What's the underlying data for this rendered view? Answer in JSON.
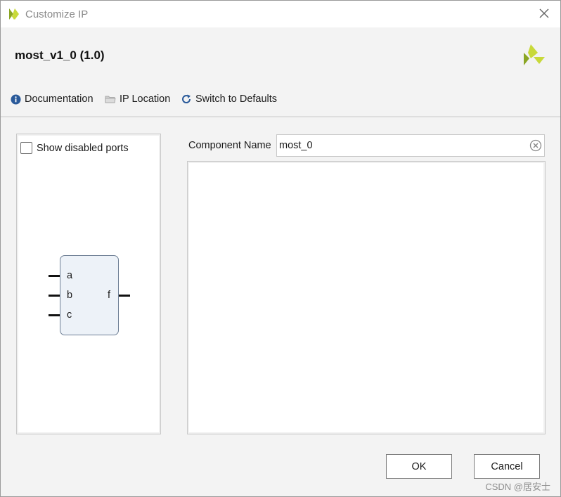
{
  "window": {
    "title": "Customize IP",
    "icons": {
      "app": "xilinx-logo-icon",
      "close": "close-icon"
    }
  },
  "header": {
    "ip_title": "most_v1_0 (1.0)",
    "brand_icon": "xilinx-logo-icon"
  },
  "toolbar": {
    "documentation": "Documentation",
    "ip_location": "IP Location",
    "switch_defaults": "Switch to Defaults",
    "icons": [
      "info-icon",
      "folder-icon",
      "refresh-icon"
    ]
  },
  "left_panel": {
    "show_disabled_label": "Show disabled ports",
    "show_disabled_checked": false,
    "block": {
      "inputs": [
        "a",
        "b",
        "c"
      ],
      "outputs": [
        "f"
      ]
    }
  },
  "right_panel": {
    "component_name_label": "Component Name",
    "component_name_value": "most_0"
  },
  "buttons": {
    "ok": "OK",
    "cancel": "Cancel"
  },
  "watermark": "CSDN @居安士",
  "colors": {
    "brand_yellow": "#c8d93a",
    "brand_green": "#8aa523",
    "info_blue": "#2a5a9a",
    "block_fill": "#edf2f8",
    "block_border": "#6e7f95"
  }
}
